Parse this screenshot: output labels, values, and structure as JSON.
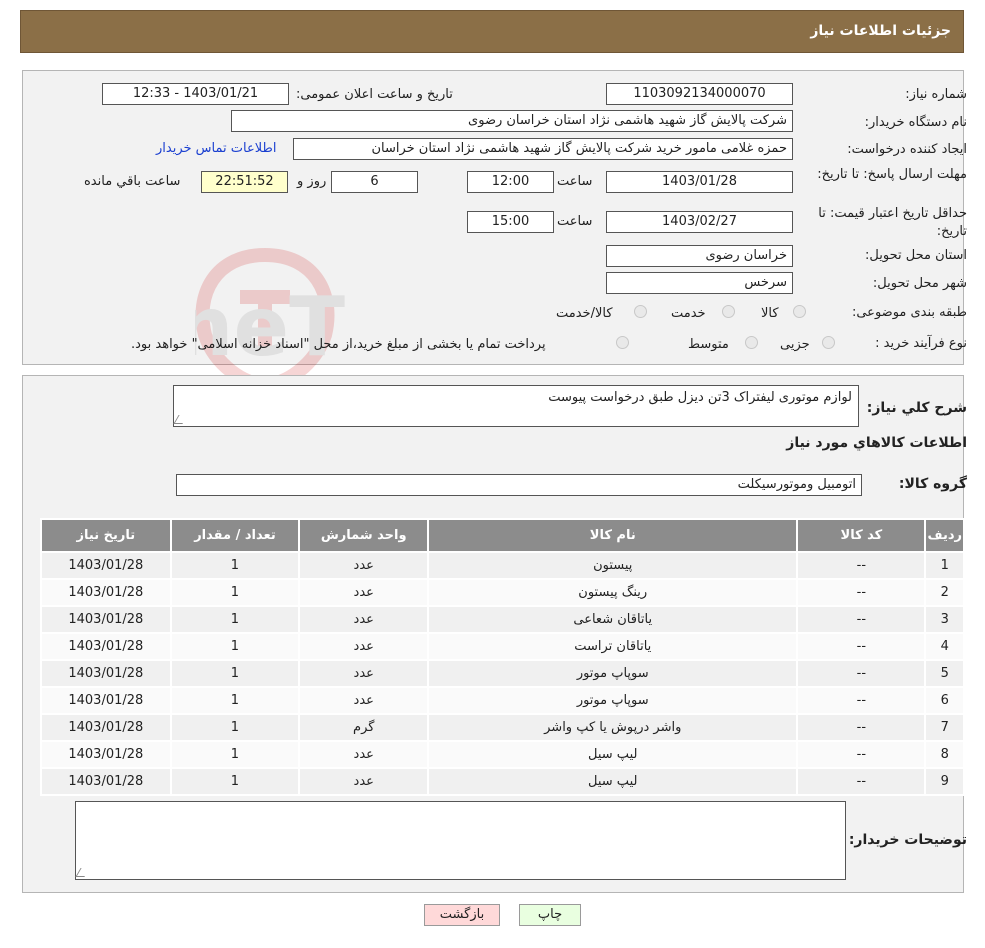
{
  "header": {
    "title": "جزئیات اطلاعات نیاز"
  },
  "fields": {
    "need_number_label": "شماره نیاز:",
    "need_number": "1103092134000070",
    "announce_label": "تاریخ و ساعت اعلان عمومی:",
    "announce_value": "1403/01/21 - 12:33",
    "buyer_org_label": "نام دستگاه خریدار:",
    "buyer_org": "شرکت پالایش گاز شهید هاشمی نژاد   استان خراسان رضوی",
    "requester_label": "ایجاد کننده درخواست:",
    "requester": "حمزه غلامی مامور خرید شرکت پالایش گاز شهید هاشمی نژاد   استان خراسان",
    "contact_link": "اطلاعات تماس خریدار",
    "reply_deadline_label": "مهلت ارسال پاسخ: تا تاریخ:",
    "reply_date": "1403/01/28",
    "time_label": "ساعت",
    "reply_time": "12:00",
    "days_value": "6",
    "days_label": "روز و",
    "remaining_time": "22:51:52",
    "remaining_label": "ساعت باقي مانده",
    "price_validity_label": "حداقل تاریخ اعتبار قیمت: تا تاریخ:",
    "price_date": "1403/02/27",
    "price_time": "15:00",
    "province_label": "استان محل تحویل:",
    "province": "خراسان رضوی",
    "city_label": "شهر محل تحویل:",
    "city": "سرخس",
    "category_label": "طبقه بندی موضوعی:",
    "category_options": [
      "کالا",
      "خدمت",
      "کالا/خدمت"
    ],
    "process_label": "نوع فرآیند خرید :",
    "process_options": [
      "جزیی",
      "متوسط"
    ],
    "process_note": "پرداخت تمام یا بخشی از مبلغ خرید،از محل \"اسناد خزانه اسلامی\" خواهد بود."
  },
  "details": {
    "summary_label": "شرح کلي نياز:",
    "summary": "لوازم موتوری لیفتراک 3تن دیزل طبق درخواست پیوست",
    "items_title": "اطلاعات کالاهاي مورد نياز",
    "group_label": "گروه کالا:",
    "group_value": "اتومبیل وموتورسیکلت"
  },
  "table": {
    "headers": [
      "ردیف",
      "کد کالا",
      "نام کالا",
      "واحد شمارش",
      "تعداد / مقدار",
      "تاریخ نیاز"
    ],
    "rows": [
      [
        "1",
        "--",
        "پیستون",
        "عدد",
        "1",
        "1403/01/28"
      ],
      [
        "2",
        "--",
        "رینگ پیستون",
        "عدد",
        "1",
        "1403/01/28"
      ],
      [
        "3",
        "--",
        "یاتاقان شعاعی",
        "عدد",
        "1",
        "1403/01/28"
      ],
      [
        "4",
        "--",
        "یاتاقان تراست",
        "عدد",
        "1",
        "1403/01/28"
      ],
      [
        "5",
        "--",
        "سوپاپ موتور",
        "عدد",
        "1",
        "1403/01/28"
      ],
      [
        "6",
        "--",
        "سوپاپ موتور",
        "عدد",
        "1",
        "1403/01/28"
      ],
      [
        "7",
        "--",
        "واشر درپوش یا کپ واشر",
        "گرم",
        "1",
        "1403/01/28"
      ],
      [
        "8",
        "--",
        "لیپ سیل",
        "عدد",
        "1",
        "1403/01/28"
      ],
      [
        "9",
        "--",
        "لیپ سیل",
        "عدد",
        "1",
        "1403/01/28"
      ]
    ]
  },
  "buyer_notes": {
    "label": "توضیحات خریدار:",
    "value": ""
  },
  "buttons": {
    "print": "چاپ",
    "back": "بازگشت"
  },
  "watermark": {
    "text": "AriaTender.neT",
    "icon": "tender-logo-icon"
  }
}
